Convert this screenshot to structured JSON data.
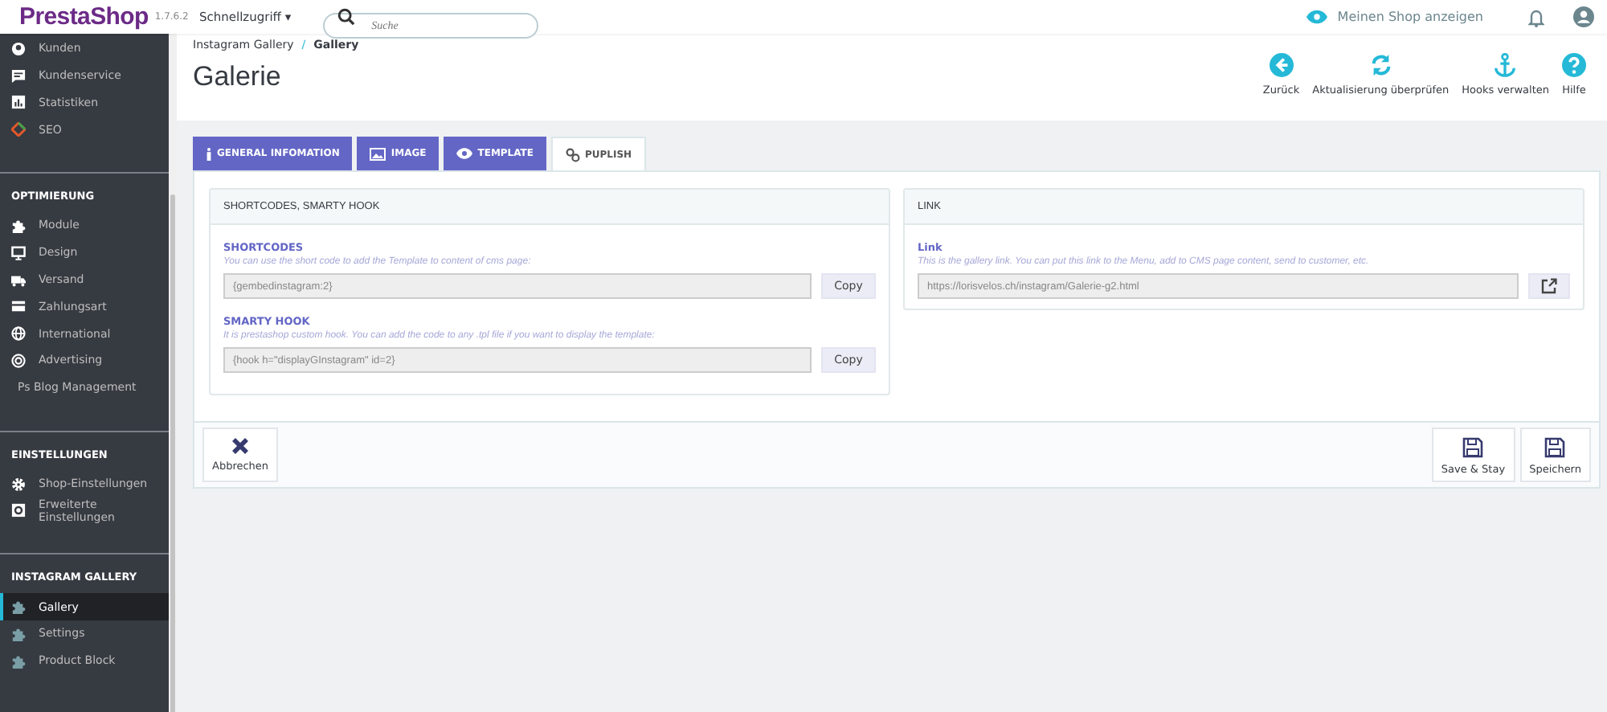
{
  "header": {
    "logo": "PrestaShop",
    "version": "1.7.6.2",
    "quick_access": "Schnellzugriff",
    "quick_access_caret": "▾",
    "search": {
      "placeholder": "Suche"
    },
    "view_shop": "Meinen Shop anzeigen"
  },
  "sidebar": {
    "sections": [
      {
        "items": [
          {
            "label": "Kunden",
            "selected": false
          },
          {
            "label": "Kundenservice",
            "selected": false
          },
          {
            "label": "Statistiken",
            "selected": false
          },
          {
            "label": "SEO",
            "selected": false
          }
        ]
      },
      {
        "title": "OPTIMIERUNG",
        "items": [
          {
            "label": "Module",
            "selected": false
          },
          {
            "label": "Design",
            "selected": false
          },
          {
            "label": "Versand",
            "selected": false
          },
          {
            "label": "Zahlungsart",
            "selected": false
          },
          {
            "label": "International",
            "selected": false
          },
          {
            "label": "Advertising",
            "selected": false
          },
          {
            "label": "Ps Blog Management",
            "selected": false
          }
        ]
      },
      {
        "title": "EINSTELLUNGEN",
        "items": [
          {
            "label": "Shop-Einstellungen",
            "selected": false
          },
          {
            "label": "Erweiterte Einstellungen",
            "selected": false
          }
        ]
      },
      {
        "title": "INSTAGRAM GALLERY",
        "items": [
          {
            "label": "Gallery",
            "selected": true
          },
          {
            "label": "Settings",
            "selected": false
          },
          {
            "label": "Product Block",
            "selected": false
          }
        ]
      }
    ]
  },
  "breadcrumb": [
    "Instagram Gallery",
    "Gallery"
  ],
  "breadcrumb_separator": "/",
  "page_title": "Galerie",
  "toolbar": [
    {
      "label": "Zurück"
    },
    {
      "label": "Aktualisierung überprüfen"
    },
    {
      "label": "Hooks verwalten"
    },
    {
      "label": "Hilfe"
    }
  ],
  "tabs": [
    {
      "label": "GENERAL INFOMATION",
      "selected": false
    },
    {
      "label": "IMAGE",
      "selected": false
    },
    {
      "label": "TEMPLATE",
      "selected": false
    },
    {
      "label": "PUPLISH",
      "selected": true
    }
  ],
  "panels": [
    {
      "title": "SHORTCODES, SMARTY HOOK",
      "fields": [
        {
          "label": "SHORTCODES",
          "help": "You can use the short code to add the Template to content of cms page:",
          "value": "{gembedinstagram:2}",
          "kind": "copy",
          "button": "Copy"
        },
        {
          "label": "SMARTY HOOK",
          "help": "It is prestashop custom hook. You can add the code to any .tpl file if you want to display the template:",
          "value": "{hook h=\"displayGInstagram\" id=2}",
          "kind": "copy",
          "button": "Copy"
        }
      ]
    },
    {
      "title": "LINK",
      "fields": [
        {
          "label": "Link",
          "help": "This is the gallery link. You can put this link to the Menu, add to CMS page content, send to customer, etc.",
          "value": "https://lorisvelos.ch/instagram/Galerie-g2.html",
          "kind": "open"
        }
      ]
    }
  ],
  "footer": {
    "cancel": "Abbrechen",
    "save_stay": "Save & Stay",
    "save": "Speichern"
  }
}
